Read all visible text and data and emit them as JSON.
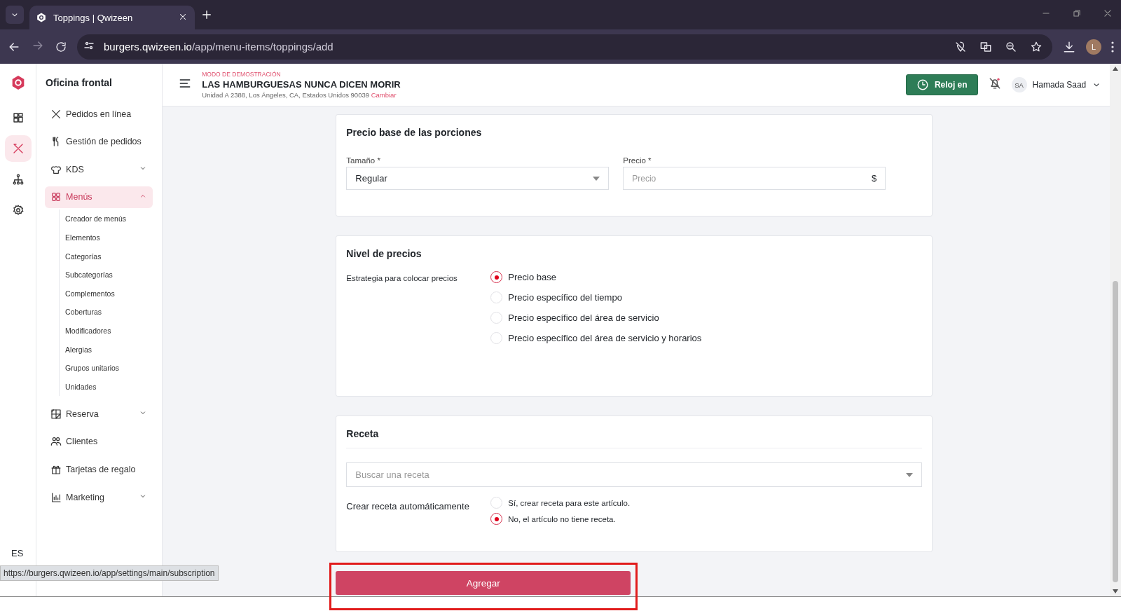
{
  "browser": {
    "tab_title": "Toppings | Qwizeen",
    "url_host": "burgers.qwizeen.io",
    "url_path": "/app/menu-items/toppings/add",
    "avatar": "L",
    "status_url": "https://burgers.qwizeen.io/app/settings/main/subscription"
  },
  "rail": [
    {
      "selected": false
    },
    {
      "selected": true
    },
    {
      "selected": false
    },
    {
      "selected": false
    }
  ],
  "sidebar": {
    "title": "Oficina frontal",
    "language": "ES",
    "items": [
      {
        "label": "Pedidos en línea",
        "selected": false
      },
      {
        "label": "Gestión de pedidos",
        "selected": false
      },
      {
        "label": "KDS",
        "selected": false,
        "expanded": false
      },
      {
        "label": "Menús",
        "selected": true,
        "expanded": true,
        "children": [
          {
            "label": "Creador de menús"
          },
          {
            "label": "Elementos"
          },
          {
            "label": "Categorías"
          },
          {
            "label": "Subcategorías"
          },
          {
            "label": "Complementos"
          },
          {
            "label": "Coberturas"
          },
          {
            "label": "Modificadores"
          },
          {
            "label": "Alergias"
          },
          {
            "label": "Grupos unitarios"
          },
          {
            "label": "Unidades"
          }
        ]
      },
      {
        "label": "Reserva",
        "selected": false,
        "expanded": false
      },
      {
        "label": "Clientes",
        "selected": false
      },
      {
        "label": "Tarjetas de regalo",
        "selected": false
      },
      {
        "label": "Marketing",
        "selected": false,
        "expanded": false
      }
    ]
  },
  "header": {
    "demo_label": "MODO DE DEMOSTRACIÓN",
    "restaurant": "LAS HAMBURGUESAS NUNCA DICEN MORIR",
    "address": "Unidad A 2388, Los Ángeles, CA, Estados Unidos 90039",
    "change_link": "Cambiar",
    "clock_button": "Reloj en",
    "user_initials": "SA",
    "user_name": "Hamada Saad"
  },
  "portions": {
    "title": "Precio base de las porciones",
    "size_label": "Tamaño *",
    "size_value": "Regular",
    "price_label": "Precio *",
    "price_placeholder": "Precio",
    "currency": "$"
  },
  "pricing": {
    "title": "Nivel de precios",
    "label": "Estrategia para colocar precios",
    "options": [
      {
        "label": "Precio base",
        "selected": true
      },
      {
        "label": "Precio específico del tiempo",
        "selected": false
      },
      {
        "label": "Precio específico del área de servicio",
        "selected": false
      },
      {
        "label": "Precio específico del área de servicio y horarios",
        "selected": false
      }
    ]
  },
  "recipe": {
    "title": "Receta",
    "search_placeholder": "Buscar una receta",
    "auto_label": "Crear receta automáticamente",
    "options": [
      {
        "label": "Sí, crear receta para este artículo.",
        "selected": false
      },
      {
        "label": "No, el artículo no tiene receta.",
        "selected": true
      }
    ]
  },
  "submit": {
    "label": "Agregar",
    "highlighted": true
  }
}
